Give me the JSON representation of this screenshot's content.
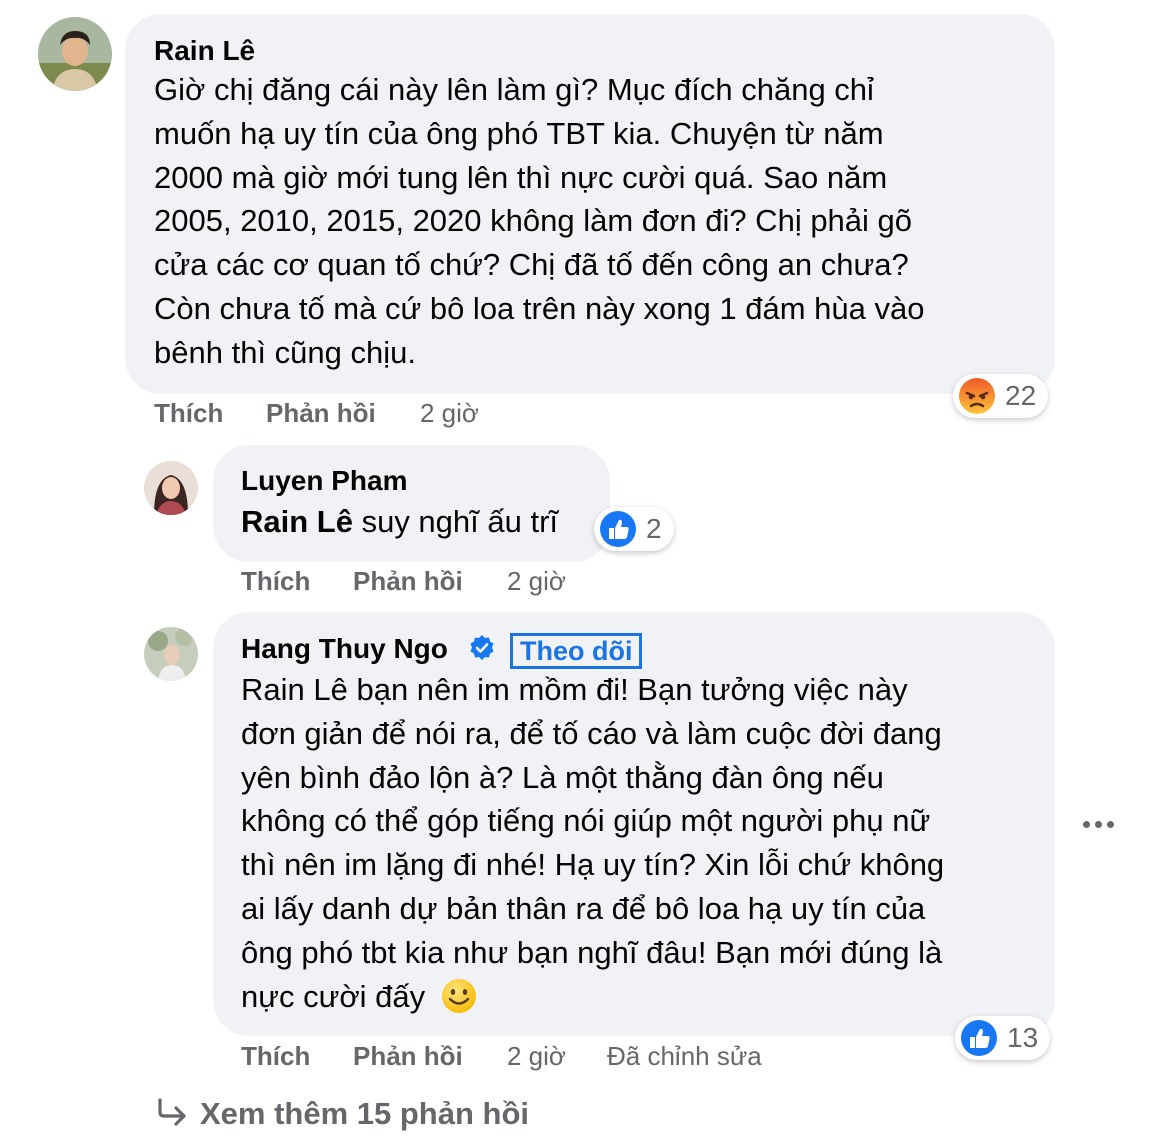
{
  "comments": [
    {
      "author": "Rain Lê",
      "lines": [
        "Giờ chị đăng cái này lên làm gì? Mục đích chăng chỉ",
        "muốn hạ uy tín của ông phó TBT kia. Chuyện từ năm",
        "2000 mà giờ mới tung lên thì nực cười quá. Sao năm",
        "2005, 2010, 2015, 2020 không làm đơn đi? Chị phải gõ",
        "cửa các cơ quan tố chứ? Chị đã tố đến công an chưa?",
        "Còn chưa tố mà cứ bô loa trên này xong 1 đám hùa vào",
        "bênh thì cũng chịu."
      ],
      "like_label": "Thích",
      "reply_label": "Phản hồi",
      "time": "2 giờ",
      "reaction": {
        "icon": "angry-reaction-icon",
        "count": "22"
      }
    },
    {
      "author": "Luyen Pham",
      "mention": "Rain Lê",
      "text": " suy nghĩ ấu trĩ",
      "like_label": "Thích",
      "reply_label": "Phản hồi",
      "time": "2 giờ",
      "reaction": {
        "icon": "like-reaction-icon",
        "count": "2"
      }
    },
    {
      "author": "Hang Thuy Ngo",
      "verified_icon": "verified-badge-icon",
      "follow_label": "Theo dõi",
      "lines": [
        "Rain Lê bạn nên im mồm đi! Bạn tưởng việc này",
        "đơn giản để nói ra, để tố cáo và làm cuộc đời đang",
        "yên bình đảo lộn à? Là một thằng đàn ông nếu",
        "không có thể góp tiếng nói giúp một người phụ nữ",
        "thì nên im lặng đi nhé! Hạ uy tín? Xin lỗi chứ không",
        "ai lấy danh dự bản thân ra để bô loa hạ uy tín của",
        "ông phó tbt kia như bạn nghĩ đâu! Bạn mới đúng là",
        "nực cười đấy"
      ],
      "emoji_icon": "smiling-face-emoji-icon",
      "like_label": "Thích",
      "reply_label": "Phản hồi",
      "time": "2 giờ",
      "edited_label": "Đã chỉnh sửa",
      "reaction": {
        "icon": "like-reaction-icon",
        "count": "13"
      }
    }
  ],
  "more_options_icon": "more-horizontal-icon",
  "view_more": {
    "icon": "reply-arrow-icon",
    "label": "Xem thêm 15 phản hồi"
  },
  "colors": {
    "bubble": "#f0f2f5",
    "secondary_text": "#65676b",
    "link_blue": "#1b74e4",
    "like_blue": "#1877f2",
    "angry_orange": "#f05a28"
  }
}
